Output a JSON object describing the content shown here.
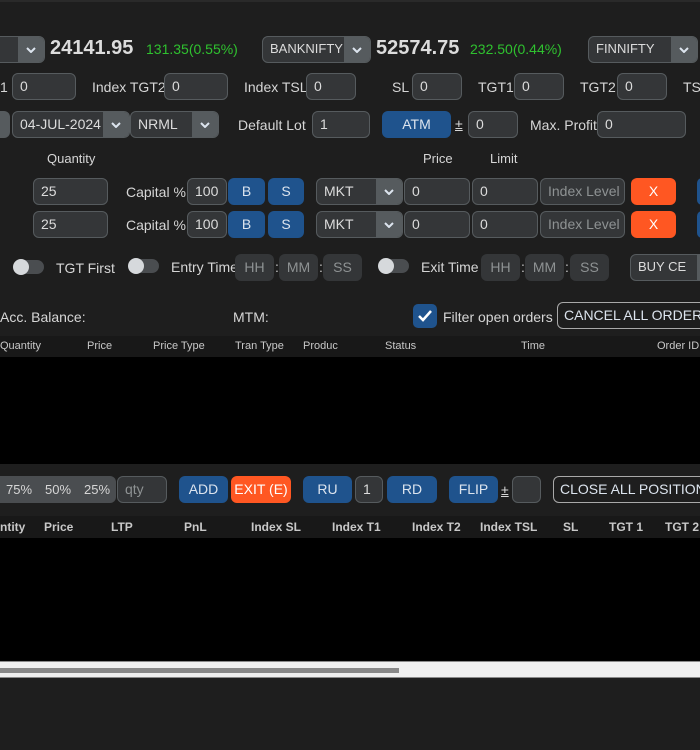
{
  "ticker": {
    "nifty": {
      "price": "24141.95",
      "change": "131.35(0.55%)"
    },
    "banknifty": {
      "symbol": "BANKNIFTY",
      "price": "52574.75",
      "change": "232.50(0.44%)"
    },
    "finnifty": {
      "symbol": "FINNIFTY"
    }
  },
  "targets": {
    "index_tgt1_suffix": "1",
    "index_tgt1_value": "0",
    "index_tgt2_label": "Index TGT2",
    "index_tgt2_value": "0",
    "index_tsl_label": "Index TSL",
    "index_tsl_value": "0",
    "sl_label": "SL",
    "sl_value": "0",
    "tgt1_label": "TGT1",
    "tgt1_value": "0",
    "tgt2_label": "TGT2",
    "tgt2_value": "0",
    "tsl_label": "TS"
  },
  "settings": {
    "expiry": "04-JUL-2024",
    "product": "NRML",
    "default_lot_label": "Default Lot",
    "default_lot_value": "1",
    "atm_label": "ATM",
    "plus_minus": "±",
    "atm_offset": "0",
    "max_profit_label": "Max. Profit",
    "max_profit_value": "0"
  },
  "order_headers": {
    "quantity": "Quantity",
    "price": "Price",
    "limit": "Limit"
  },
  "order_rows": [
    {
      "quantity": "25",
      "capital_label": "Capital %",
      "capital": "100",
      "buy": "B",
      "sell": "S",
      "price_type": "MKT",
      "price": "0",
      "limit": "0",
      "index_level_placeholder": "Index Level",
      "cancel": "X"
    },
    {
      "quantity": "25",
      "capital_label": "Capital %",
      "capital": "100",
      "buy": "B",
      "sell": "S",
      "price_type": "MKT",
      "price": "0",
      "limit": "0",
      "index_level_placeholder": "Index Level",
      "cancel": "X"
    }
  ],
  "timing": {
    "tgt_first_label": "TGT First",
    "entry_time_label": "Entry Time",
    "exit_time_label": "Exit Time",
    "hh": "HH",
    "mm": "MM",
    "ss": "SS",
    "colon": ":",
    "strategy": "BUY CE"
  },
  "account": {
    "balance_label": "Acc. Balance:",
    "mtm_label": "MTM:",
    "filter_label": "Filter open orders",
    "filter_checked": true,
    "cancel_all_label": "CANCEL ALL ORDERS (("
  },
  "orders_table": {
    "columns": [
      "Quantity",
      "Price",
      "Price Type",
      "Tran Type",
      "Produc",
      "Status",
      "Time",
      "Order ID"
    ]
  },
  "positions_toolbar": {
    "pct_75": "75%",
    "pct_50": "50%",
    "pct_25": "25%",
    "qty_placeholder": "qty",
    "add_label": "ADD",
    "exit_label": "EXIT (E)",
    "ru_label": "RU",
    "step_value": "1",
    "rd_label": "RD",
    "flip_label": "FLIP",
    "plus_minus": "±",
    "flip_offset": "",
    "close_all_label": "CLOSE ALL POSITIONS (("
  },
  "positions_table": {
    "columns": [
      "ntity",
      "Price",
      "LTP",
      "PnL",
      "Index SL",
      "Index T1",
      "Index T2",
      "Index TSL",
      "SL",
      "TGT 1",
      "TGT 2"
    ]
  },
  "scrollbar": {
    "position_fraction": 0.57
  }
}
